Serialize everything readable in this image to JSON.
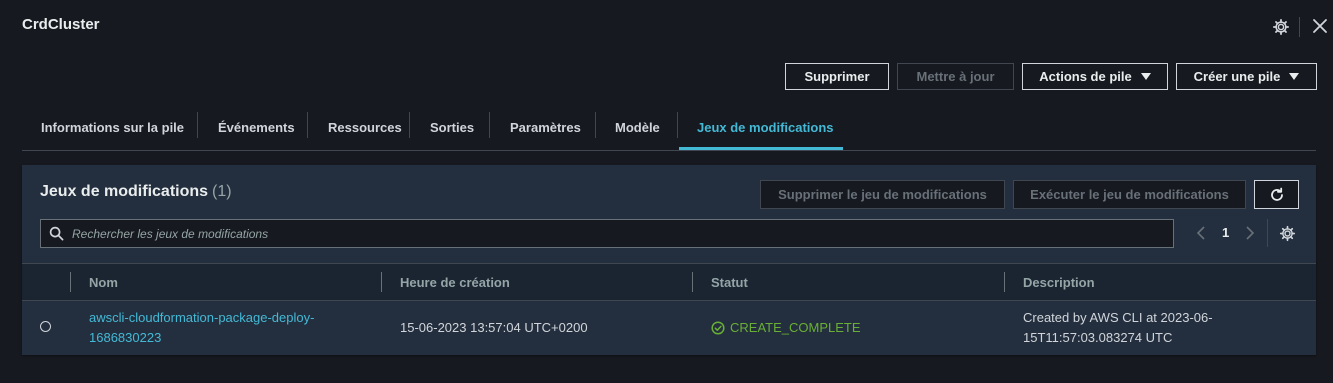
{
  "header": {
    "title": "CrdCluster",
    "settings_icon": "gear-icon",
    "close_icon": "close-icon"
  },
  "actions": {
    "delete": "Supprimer",
    "update": "Mettre à jour",
    "stack_actions": "Actions de pile",
    "create_stack": "Créer une pile"
  },
  "tabs": [
    {
      "label": "Informations sur la pile",
      "active": false
    },
    {
      "label": "Événements",
      "active": false
    },
    {
      "label": "Ressources",
      "active": false
    },
    {
      "label": "Sorties",
      "active": false
    },
    {
      "label": "Paramètres",
      "active": false
    },
    {
      "label": "Modèle",
      "active": false
    },
    {
      "label": "Jeux de modifications",
      "active": true
    }
  ],
  "panel": {
    "title": "Jeux de modifications",
    "count": "(1)",
    "delete_changeset": "Supprimer le jeu de modifications",
    "execute_changeset": "Exécuter le jeu de modifications",
    "refresh_icon": "refresh-icon",
    "search": {
      "placeholder": "Rechercher les jeux de modifications",
      "value": ""
    },
    "pagination": {
      "page": "1"
    },
    "preferences_icon": "gear-icon"
  },
  "table": {
    "columns": [
      "Nom",
      "Heure de création",
      "Statut",
      "Description"
    ],
    "rows": [
      {
        "name": "awscli-cloudformation-package-deploy-1686830223",
        "created": "15-06-2023 13:57:04 UTC+0200",
        "status": "CREATE_COMPLETE",
        "description": "Created by AWS CLI at 2023-06-15T11:57:03.083274 UTC"
      }
    ]
  },
  "colors": {
    "accent": "#44b9d6",
    "success": "#6aaf35",
    "background": "#16191f",
    "panel": "#232f3e"
  }
}
